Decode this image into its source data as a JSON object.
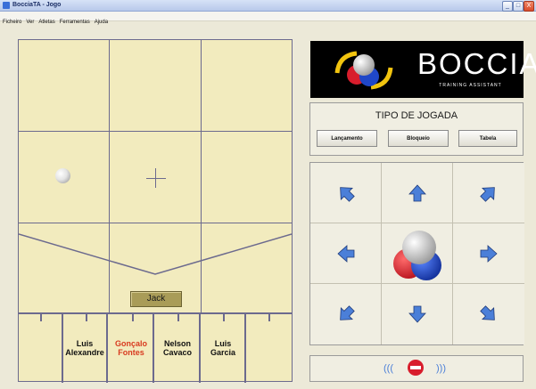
{
  "window": {
    "title": "BocciaTA - Jogo",
    "minimize": "_",
    "maximize": "□",
    "close": "X"
  },
  "menu": [
    "Ficheiro",
    "Ver",
    "Atletas",
    "Ferramentas",
    "Ajuda"
  ],
  "court": {
    "jack_label": "Jack"
  },
  "athletes": [
    {
      "first": "",
      "last": "",
      "active": false
    },
    {
      "first": "Luis",
      "last": "Alexandre",
      "active": false
    },
    {
      "first": "Gonçalo",
      "last": "Fontes",
      "active": true
    },
    {
      "first": "Nelson",
      "last": "Cavaco",
      "active": false
    },
    {
      "first": "Luis",
      "last": "Garcia",
      "active": false
    },
    {
      "first": "",
      "last": "",
      "active": false
    }
  ],
  "logo": {
    "word": "BOCCIA",
    "subtitle": "TRAINING ASSISTANT"
  },
  "play_type": {
    "heading": "TIPO DE JOGADA",
    "buttons": [
      "Lançamento",
      "Bloqueio",
      "Tabela"
    ]
  },
  "direction_icons": [
    "arrow-up-left-icon",
    "arrow-up-icon",
    "arrow-up-right-icon",
    "arrow-left-icon",
    "balls-icon",
    "arrow-right-icon",
    "arrow-down-left-icon",
    "arrow-down-icon",
    "arrow-down-right-icon"
  ],
  "status": {
    "left_signal": "(((",
    "right_signal": ")))"
  },
  "colors": {
    "court": "#f2ebbe",
    "court_lines": "#6c6a8e",
    "accent_blue": "#4b7fd8",
    "active_name": "#d83a1f",
    "stop_red": "#d81d2c"
  }
}
